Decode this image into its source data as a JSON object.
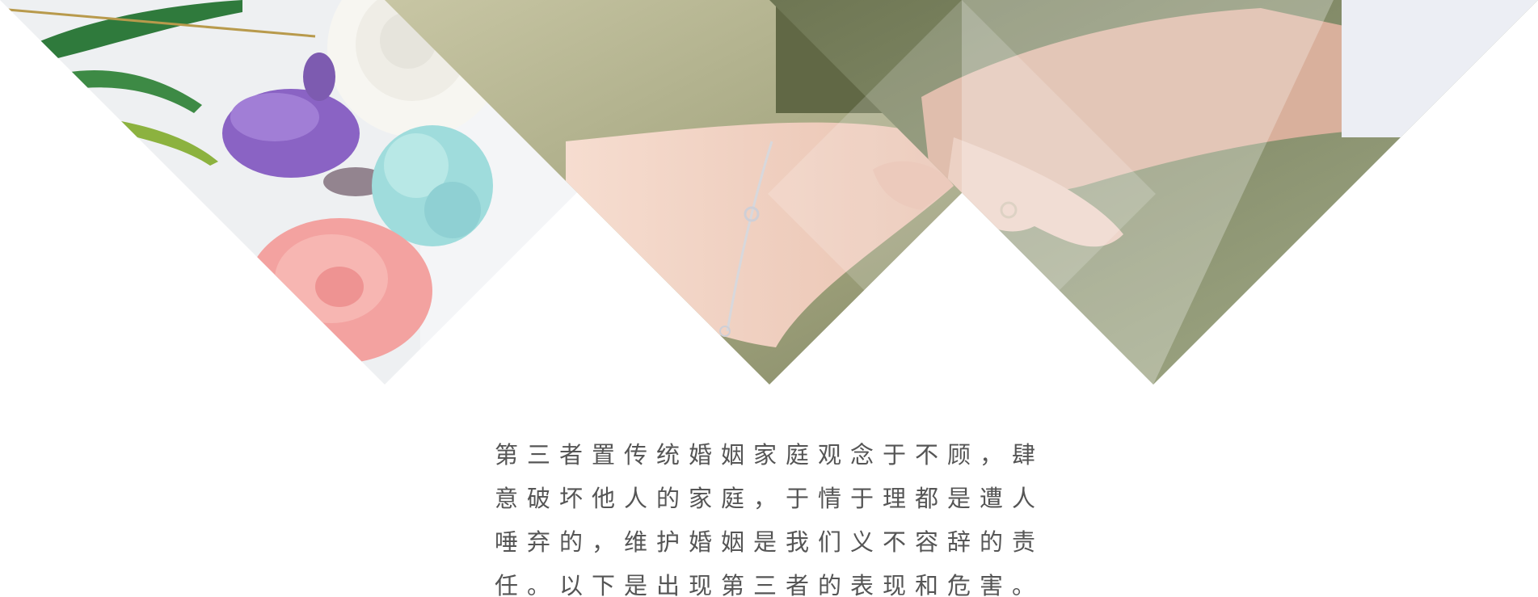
{
  "banner": {
    "panels": [
      {
        "subject": "bouquet of white, purple, blue and pink flowers"
      },
      {
        "subject": "hand wearing a silver bracelet"
      },
      {
        "subject": "couple holding hands with ring"
      }
    ]
  },
  "intro": {
    "lines": [
      "第三者置传统婚姻家庭观念于不顾，肆",
      "意破坏他人的家庭，于情于理都是遭人",
      "唾弃的，维护婚姻是我们义不容辞的责",
      "任。以下是出现第三者的表现和危害。"
    ]
  }
}
